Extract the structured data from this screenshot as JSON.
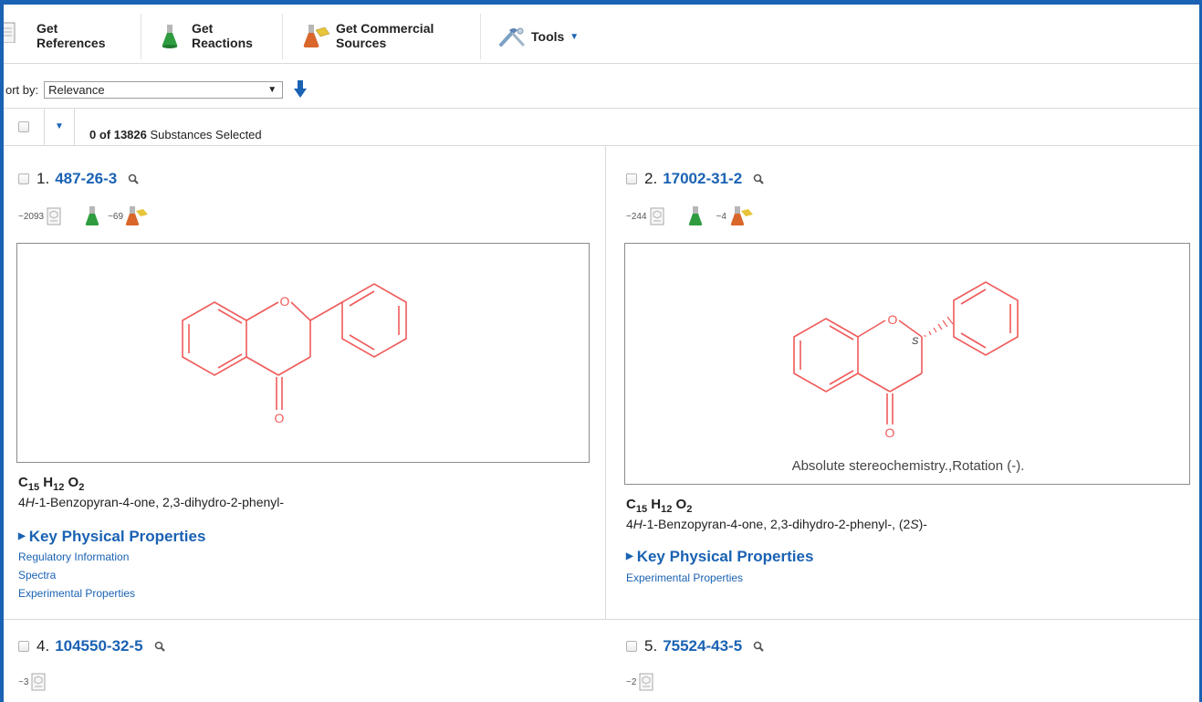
{
  "toolbar": {
    "references_label_1": "Get",
    "references_label_2": "References",
    "reactions_label_1": "Get",
    "reactions_label_2": "Reactions",
    "commercial_label_1": "Get Commercial",
    "commercial_label_2": "Sources",
    "tools_label": "Tools"
  },
  "sort": {
    "label": "ort by:",
    "selected": "Relevance"
  },
  "selection": {
    "selected_count": "0 of 13826",
    "suffix": "Substances Selected"
  },
  "colors": {
    "accent": "#1a62b3",
    "structure": "#f05a5a",
    "reactions_flask": "#2e9c3f",
    "commercial_flask": "#d9662b"
  },
  "icons": [
    "document-icon",
    "green-flask-icon",
    "orange-flask-icon",
    "tools-icon",
    "magnifier-icon",
    "sort-down-arrow-icon",
    "chevron-down-icon"
  ],
  "results": [
    {
      "index": "1.",
      "cas": "487-26-3",
      "ref_count": "~2093",
      "commercial_count": "~69",
      "formula": {
        "c": "C",
        "c_n": "15",
        "h": "H",
        "h_n": "12",
        "o": "O",
        "o_n": "2"
      },
      "name_prefix": "4",
      "name_h": "H",
      "name_rest": "-1-Benzopyran-4-one, 2,3-dihydro-2-phenyl-",
      "key_props": "Key Physical Properties",
      "links": [
        "Regulatory Information",
        "Spectra",
        "Experimental Properties"
      ],
      "atom_o": "O",
      "atom_ketone": "O"
    },
    {
      "index": "2.",
      "cas": "17002-31-2",
      "ref_count": "~244",
      "commercial_count": "~4",
      "formula": {
        "c": "C",
        "c_n": "15",
        "h": "H",
        "h_n": "12",
        "o": "O",
        "o_n": "2"
      },
      "name_prefix": "4",
      "name_h": "H",
      "name_rest": "-1-Benzopyran-4-one, 2,3-dihydro-2-phenyl-, (2",
      "name_s": "S",
      "name_end": ")-",
      "caption": "Absolute stereochemistry.,Rotation (-).",
      "stereo": "S",
      "key_props": "Key Physical Properties",
      "links": [
        "Experimental Properties"
      ],
      "atom_o": "O",
      "atom_ketone": "O"
    },
    {
      "index": "4.",
      "cas": "104550-32-5",
      "ref_count": "~3"
    },
    {
      "index": "5.",
      "cas": "75524-43-5",
      "ref_count": "~2"
    }
  ]
}
